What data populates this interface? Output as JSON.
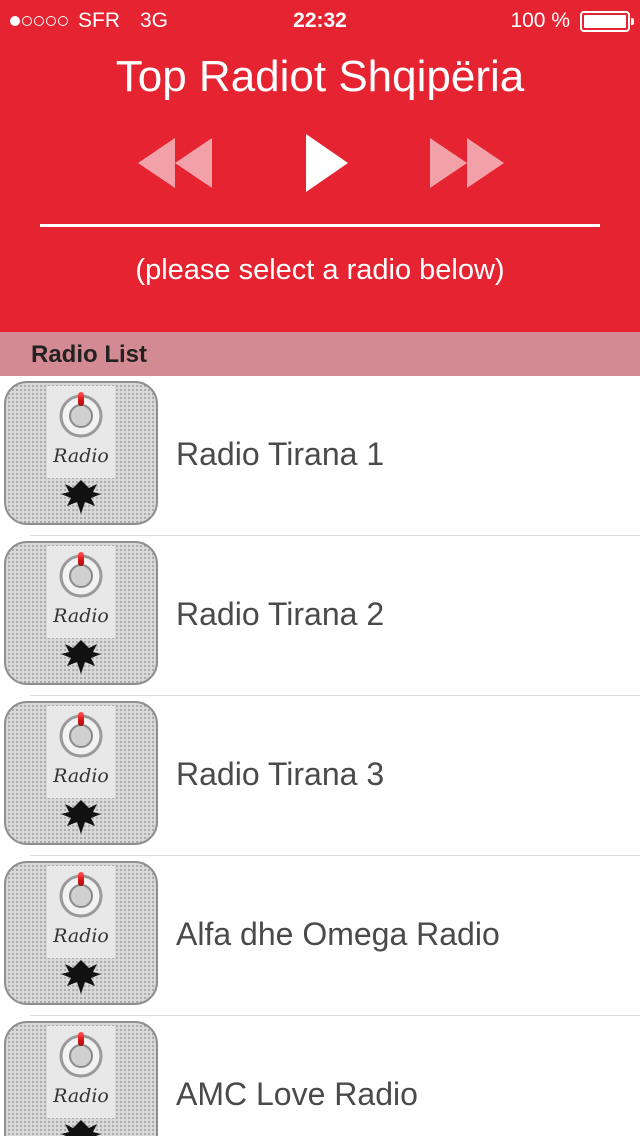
{
  "status_bar": {
    "signal_dots_filled": 1,
    "signal_dots_total": 5,
    "carrier": "SFR",
    "network": "3G",
    "time": "22:32",
    "battery_text": "100 %",
    "battery_level_percent": 100
  },
  "header": {
    "title": "Top Radiot Shqipëria",
    "hint": "(please select a radio below)",
    "background_color": "#e52331",
    "controls": {
      "rewind_icon": "rewind-icon",
      "play_icon": "play-icon",
      "forward_icon": "fast-forward-icon"
    }
  },
  "section": {
    "title": "Radio List",
    "background_color": "#d48a92"
  },
  "radios": [
    {
      "name": "Radio Tirana 1",
      "icon": "albania-radio-app-icon",
      "icon_text": "Radio"
    },
    {
      "name": "Radio Tirana 2",
      "icon": "albania-radio-app-icon",
      "icon_text": "Radio"
    },
    {
      "name": "Radio Tirana 3",
      "icon": "albania-radio-app-icon",
      "icon_text": "Radio"
    },
    {
      "name": "Alfa dhe Omega Radio",
      "icon": "albania-radio-app-icon",
      "icon_text": "Radio"
    },
    {
      "name": "AMC Love Radio",
      "icon": "albania-radio-app-icon",
      "icon_text": "Radio"
    }
  ]
}
